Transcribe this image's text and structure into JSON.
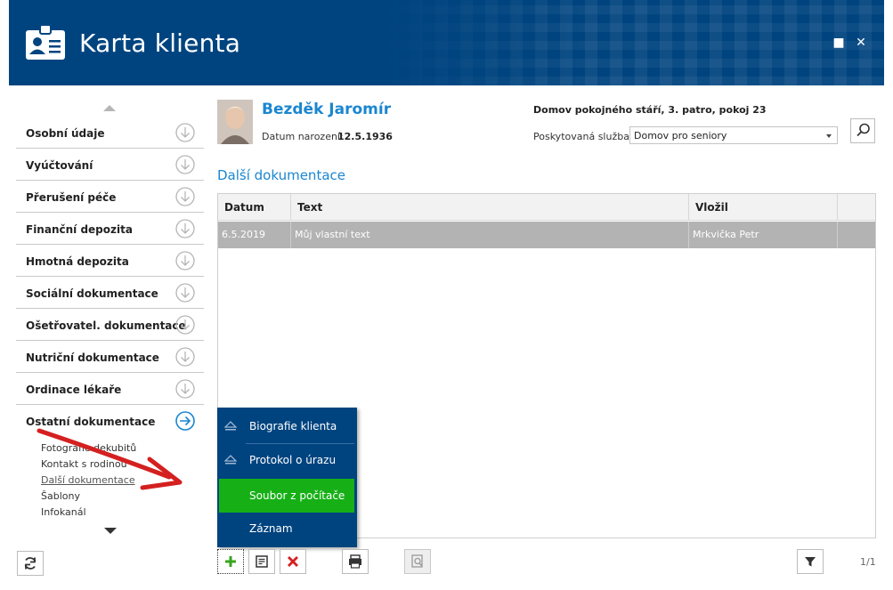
{
  "window": {
    "title": "Karta klienta",
    "maximize_glyph": "■",
    "close_glyph": "✕"
  },
  "client": {
    "name": "Bezděk Jaromír",
    "dob_label": "Datum narození:",
    "dob_value": "12.5.1936",
    "location": "Domov pokojného stáří, 3. patro, pokoj 23",
    "service_label": "Poskytovaná služba:",
    "service_value": "Domov pro seniory"
  },
  "sidebar": {
    "items": [
      {
        "label": "Osobní údaje"
      },
      {
        "label": "Vyúčtování"
      },
      {
        "label": "Přerušení péče"
      },
      {
        "label": "Finanční depozita"
      },
      {
        "label": "Hmotná depozita"
      },
      {
        "label": "Sociální dokumentace"
      },
      {
        "label": "Ošetřovatel. dokumentace"
      },
      {
        "label": "Nutriční dokumentace"
      },
      {
        "label": "Ordinace lékaře"
      },
      {
        "label": "Ostatní dokumentace",
        "active": true
      }
    ],
    "subitems": [
      {
        "label": "Fotografie dekubitů"
      },
      {
        "label": "Kontakt s rodinou"
      },
      {
        "label": "Další dokumentace",
        "active": true
      },
      {
        "label": "Šablony"
      },
      {
        "label": "Infokanál"
      }
    ]
  },
  "section": {
    "title": "Další dokumentace"
  },
  "table": {
    "columns": [
      "Datum",
      "Text",
      "Vložil"
    ],
    "rows": [
      {
        "datum": "6.5.2019",
        "text": "Můj vlastní text",
        "vlozil": "Mrkvička Petr"
      }
    ]
  },
  "popup_menu": {
    "items": [
      {
        "label": "Biografie klienta"
      },
      {
        "label": "Protokol o úrazu"
      },
      {
        "label": "Soubor z počítače",
        "highlighted": true
      },
      {
        "label": "Záznam"
      }
    ]
  },
  "toolbar": {
    "page_count": "1/1"
  },
  "colors": {
    "header_bg": "#00447f",
    "accent_blue": "#1a86d0",
    "highlight_green": "#16b016",
    "selected_row": "#b3b3b3",
    "annotation_red": "#d42020"
  }
}
